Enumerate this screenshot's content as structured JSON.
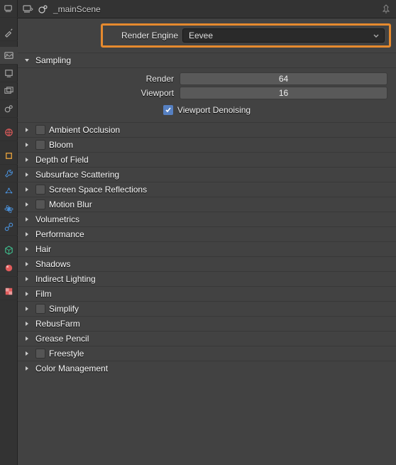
{
  "header": {
    "scene_name": "_mainScene"
  },
  "engine": {
    "label": "Render Engine",
    "value": "Eevee"
  },
  "sampling": {
    "title": "Sampling",
    "render_label": "Render",
    "render_value": "64",
    "viewport_label": "Viewport",
    "viewport_value": "16",
    "denoise_label": "Viewport Denoising",
    "denoise_checked": true
  },
  "sections": [
    {
      "label": "Ambient Occlusion",
      "checkbox": true
    },
    {
      "label": "Bloom",
      "checkbox": true
    },
    {
      "label": "Depth of Field",
      "checkbox": false
    },
    {
      "label": "Subsurface Scattering",
      "checkbox": false
    },
    {
      "label": "Screen Space Reflections",
      "checkbox": true
    },
    {
      "label": "Motion Blur",
      "checkbox": true
    },
    {
      "label": "Volumetrics",
      "checkbox": false
    },
    {
      "label": "Performance",
      "checkbox": false
    },
    {
      "label": "Hair",
      "checkbox": false
    },
    {
      "label": "Shadows",
      "checkbox": false
    },
    {
      "label": "Indirect Lighting",
      "checkbox": false
    },
    {
      "label": "Film",
      "checkbox": false
    },
    {
      "label": "Simplify",
      "checkbox": true
    },
    {
      "label": "RebusFarm",
      "checkbox": false
    },
    {
      "label": "Grease Pencil",
      "checkbox": false
    },
    {
      "label": "Freestyle",
      "checkbox": true
    },
    {
      "label": "Color Management",
      "checkbox": false
    }
  ],
  "vtabs": [
    {
      "name": "editor-type-icon",
      "color": "#aaa"
    },
    {
      "name": "tool-icon",
      "color": "#aaa"
    },
    {
      "name": "render-icon",
      "color": "#aaa",
      "active": true
    },
    {
      "name": "output-icon",
      "color": "#aaa"
    },
    {
      "name": "viewlayer-icon",
      "color": "#aaa"
    },
    {
      "name": "scene-icon",
      "color": "#aaa"
    },
    {
      "name": "world-icon",
      "color": "#e05b5b"
    },
    {
      "name": "object-icon",
      "color": "#e8a33d"
    },
    {
      "name": "modifier-icon",
      "color": "#4a90d9"
    },
    {
      "name": "particle-icon",
      "color": "#4a90d9"
    },
    {
      "name": "physics-icon",
      "color": "#4a90d9"
    },
    {
      "name": "constraint-icon",
      "color": "#4a90d9"
    },
    {
      "name": "data-icon",
      "color": "#3fbf8f"
    },
    {
      "name": "material-icon",
      "color": "#e05b5b"
    },
    {
      "name": "texture-icon",
      "color": "#e05b5b"
    }
  ]
}
